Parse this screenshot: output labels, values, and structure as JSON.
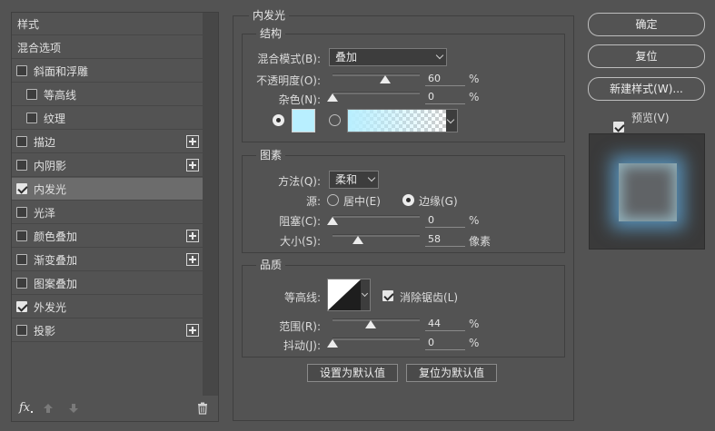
{
  "left_panel": {
    "header": "样式",
    "blend_options": "混合选项",
    "items": [
      {
        "label": "斜面和浮雕",
        "checked": false,
        "indent": false,
        "plus": false,
        "active": false
      },
      {
        "label": "等高线",
        "checked": false,
        "indent": true,
        "plus": false,
        "active": false
      },
      {
        "label": "纹理",
        "checked": false,
        "indent": true,
        "plus": false,
        "active": false
      },
      {
        "label": "描边",
        "checked": false,
        "indent": false,
        "plus": true,
        "active": false
      },
      {
        "label": "内阴影",
        "checked": false,
        "indent": false,
        "plus": true,
        "active": false
      },
      {
        "label": "内发光",
        "checked": true,
        "indent": false,
        "plus": false,
        "active": true
      },
      {
        "label": "光泽",
        "checked": false,
        "indent": false,
        "plus": false,
        "active": false
      },
      {
        "label": "颜色叠加",
        "checked": false,
        "indent": false,
        "plus": true,
        "active": false
      },
      {
        "label": "渐变叠加",
        "checked": false,
        "indent": false,
        "plus": true,
        "active": false
      },
      {
        "label": "图案叠加",
        "checked": false,
        "indent": false,
        "plus": false,
        "active": false
      },
      {
        "label": "外发光",
        "checked": true,
        "indent": false,
        "plus": false,
        "active": false
      },
      {
        "label": "投影",
        "checked": false,
        "indent": false,
        "plus": true,
        "active": false
      }
    ],
    "footer": {
      "fx_label": "fx"
    }
  },
  "main": {
    "section_title": "内发光",
    "structure": {
      "title": "结构",
      "blend_mode_label": "混合模式(B):",
      "blend_mode_value": "叠加",
      "opacity_label": "不透明度(O):",
      "opacity_value": "60",
      "opacity_unit": "%",
      "opacity_level": 0.6,
      "noise_label": "杂色(N):",
      "noise_value": "0",
      "noise_unit": "%",
      "noise_level": 0,
      "glow_color": "#b8efff"
    },
    "elements": {
      "title": "图素",
      "technique_label": "方法(Q):",
      "technique_value": "柔和",
      "source_label": "源:",
      "source_center": "居中(E)",
      "source_edge": "边缘(G)",
      "choke_label": "阻塞(C):",
      "choke_value": "0",
      "choke_unit": "%",
      "choke_level": 0,
      "size_label": "大小(S):",
      "size_value": "58",
      "size_unit": "像素",
      "size_level": 0.29
    },
    "quality": {
      "title": "品质",
      "contour_label": "等高线:",
      "antialias_label": "消除锯齿(L)",
      "range_label": "范围(R):",
      "range_value": "44",
      "range_unit": "%",
      "range_level": 0.44,
      "jitter_label": "抖动(J):",
      "jitter_value": "0",
      "jitter_unit": "%",
      "jitter_level": 0
    },
    "set_default": "设置为默认值",
    "reset_default": "复位为默认值"
  },
  "right": {
    "ok": "确定",
    "reset": "复位",
    "new_style": "新建样式(W)...",
    "preview_label": "预览(V)"
  }
}
